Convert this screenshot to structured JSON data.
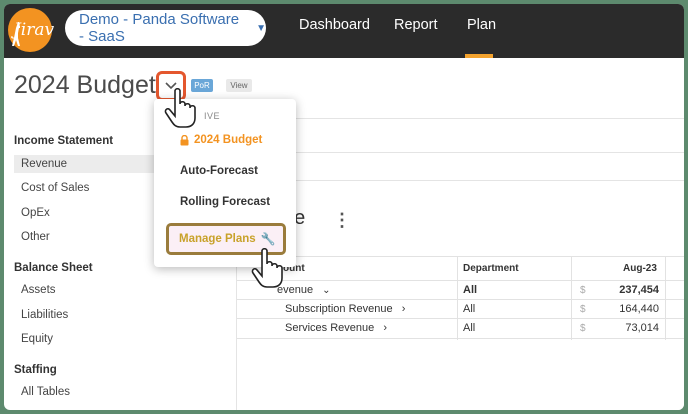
{
  "app": {
    "logo_text": "Jirav"
  },
  "header": {
    "company_select": "Demo - Panda Software - SaaS",
    "tabs": [
      "Dashboard",
      "Report",
      "Plan"
    ],
    "active_tab": "Plan"
  },
  "page": {
    "title": "2024 Budget",
    "por_badge": "PoR",
    "view_badge": "View"
  },
  "sidebar": {
    "income_statement": {
      "heading": "Income Statement",
      "items": [
        "Revenue",
        "Cost of Sales",
        "OpEx",
        "Other"
      ]
    },
    "balance_sheet": {
      "heading": "Balance Sheet",
      "items": [
        "Assets",
        "Liabilities",
        "Equity"
      ]
    },
    "staffing": {
      "heading": "Staffing",
      "items": [
        "All Tables"
      ]
    }
  },
  "dropdown": {
    "section_label": "IVE",
    "items": [
      "2024 Budget",
      "Auto-Forecast",
      "Rolling Forecast"
    ],
    "manage_label": "Manage Plans"
  },
  "main": {
    "section_title": "ue",
    "table": {
      "headers": [
        "ount",
        "Department",
        "Aug-23"
      ],
      "rows": [
        {
          "account": "evenue",
          "department": "All",
          "currency": "$",
          "value": "237,454"
        },
        {
          "account": "Subscription Revenue",
          "department": "All",
          "currency": "$",
          "value": "164,440"
        },
        {
          "account": "Services Revenue",
          "department": "All",
          "currency": "$",
          "value": "73,014"
        }
      ]
    }
  },
  "colors": {
    "topbar": "#2b2b2b",
    "accent_orange": "#f39321",
    "highlight_red": "#e4572e",
    "manage_border": "#9a7c3c"
  }
}
